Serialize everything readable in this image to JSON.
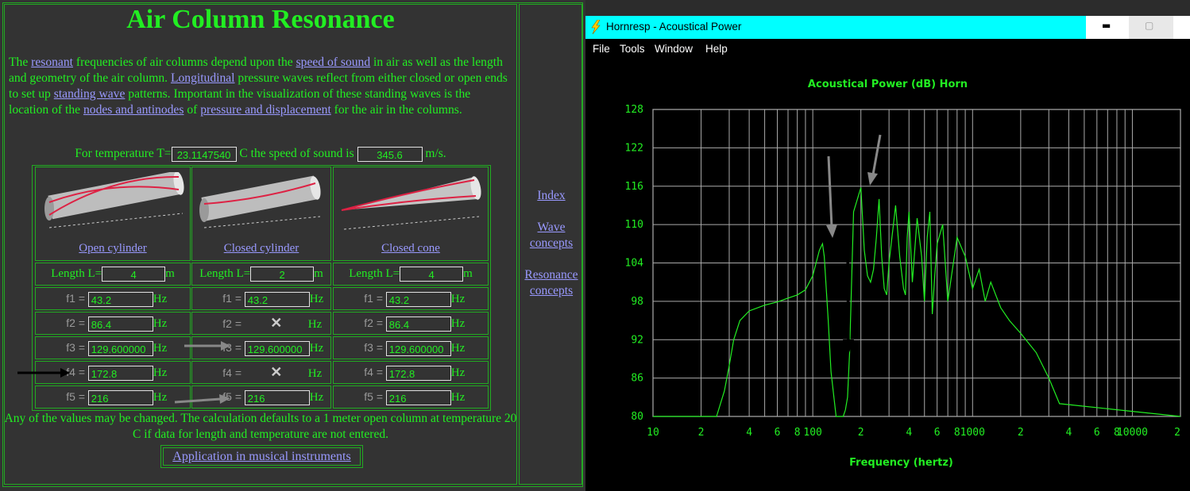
{
  "left": {
    "title": "Air Column Resonance",
    "intro": {
      "t1": "The ",
      "l_resonant": "resonant",
      "t2": " frequencies of air columns depend upon the ",
      "l_speed": "speed of sound",
      "t3": " in air as well as the length and geometry of the air column. ",
      "l_long": "Longitudinal",
      "t4": " pressure waves reflect from either closed or open ends to set up ",
      "l_standing": "standing wave",
      "t5": " patterns. Important in the visualization of these standing waves is the location of the ",
      "l_nodes": "nodes and antinodes",
      "t6": " of ",
      "l_pressure": "pressure and displacement",
      "t7": " for the air in the columns."
    },
    "temp": {
      "prefix": "For temperature T=",
      "value": "23.1147540",
      "mid": "C the speed of sound is",
      "speed": "345.6",
      "unit": "m/s."
    },
    "columns": [
      {
        "caption": "Open cylinder",
        "length_label": "Length L=",
        "length": "4",
        "length_unit": "m",
        "f": [
          "43.2",
          "86.4",
          "129.600000",
          "172.8",
          "216"
        ]
      },
      {
        "caption": "Closed cylinder",
        "length_label": "Length L=",
        "length": "2",
        "length_unit": "m",
        "f": [
          "43.2",
          "",
          "129.600000",
          "",
          "216"
        ]
      },
      {
        "caption": "Closed cone",
        "length_label": "Length L=",
        "length": "4",
        "length_unit": "m",
        "f": [
          "43.2",
          "86.4",
          "129.600000",
          "172.8",
          "216"
        ]
      }
    ],
    "freq_labels": [
      "f1 =",
      "f2 =",
      "f3 =",
      "f4 =",
      "f5 ="
    ],
    "hz": "Hz",
    "x_mark": "✕",
    "footer": "Any of the values may be changed. The calculation defaults to a 1 meter open column at temperature 20 C if data for length and temperature are not entered.",
    "app_link": "Application in musical instruments",
    "side_links": {
      "index": "Index",
      "wave": "Wave concepts",
      "resonance": "Resonance concepts"
    }
  },
  "window": {
    "title": "Hornresp - Acoustical Power",
    "menus": [
      "File",
      "Tools",
      "Window",
      "Help"
    ],
    "min_symbol": "▬",
    "max_symbol": "▢",
    "accent": "#00ffff"
  },
  "chart_data": {
    "type": "line",
    "title": "Acoustical Power (dB)   Horn",
    "xlabel": "Frequency (hertz)",
    "ylabel": "",
    "x_scale": "log",
    "xlim": [
      10,
      20000
    ],
    "ylim": [
      80,
      128
    ],
    "y_ticks": [
      "128",
      "122",
      "116",
      "110",
      "104",
      "98",
      "92",
      "86",
      "80"
    ],
    "x_ticks": [
      "10",
      "2",
      "4",
      "6",
      "8",
      "100",
      "2",
      "4",
      "6",
      "8",
      "1000",
      "2",
      "4",
      "6",
      "8",
      "10000",
      "2"
    ],
    "grid": true,
    "series_color": "#22ee22",
    "series": [
      {
        "name": "",
        "x": [
          10,
          25,
          28,
          30,
          32,
          35,
          40,
          50,
          60,
          70,
          80,
          90,
          100,
          110,
          115,
          118,
          120,
          125,
          130,
          140,
          150,
          155,
          160,
          165,
          170,
          180,
          200,
          210,
          220,
          230,
          240,
          250,
          260,
          270,
          280,
          290,
          300,
          330,
          350,
          370,
          380,
          390,
          400,
          420,
          450,
          480,
          500,
          520,
          540,
          560,
          580,
          600,
          650,
          700,
          800,
          900,
          1000,
          1100,
          1200,
          1300,
          1500,
          1700,
          2000,
          2500,
          3000,
          3500,
          20000
        ],
        "y": [
          80,
          80,
          84,
          88,
          92,
          95,
          96.5,
          97.4,
          97.9,
          98.5,
          99,
          99.8,
          102,
          106,
          107,
          105,
          102,
          95,
          87,
          80,
          80,
          80,
          81,
          83,
          90,
          112,
          115.8,
          106,
          102,
          101,
          103,
          108,
          114,
          105,
          100,
          99,
          104,
          113,
          105,
          100,
          99,
          108,
          112,
          101,
          111,
          105,
          98,
          108,
          112,
          96,
          102,
          107,
          110,
          98,
          108,
          105,
          100,
          103,
          98,
          101,
          97,
          95,
          93,
          90,
          86,
          82,
          80
        ]
      }
    ]
  }
}
